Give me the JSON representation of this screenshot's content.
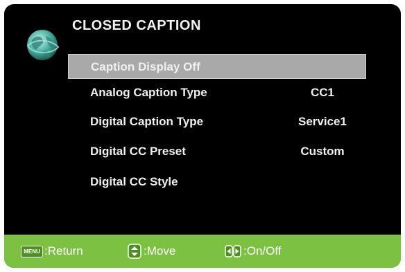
{
  "osd": {
    "title": "CLOSED CAPTION",
    "items": [
      {
        "label": "Caption Display Off",
        "value": "",
        "selected": true
      },
      {
        "label": "Analog Caption Type",
        "value": "CC1"
      },
      {
        "label": "Digital Caption Type",
        "value": "Service1"
      },
      {
        "label": "Digital CC Preset",
        "value": "Custom"
      },
      {
        "label": "Digital CC Style",
        "value": ""
      }
    ],
    "logo_icon": "globe-icon"
  },
  "footer": {
    "menu_key": "MENU",
    "return_label": ":Return",
    "move_label": ":Move",
    "onoff_label": ":On/Off",
    "menu_key_icon": "menu-key-icon",
    "move_icon": "up-down-arrows-icon",
    "onoff_icon": "left-right-arrows-icon"
  },
  "colors": {
    "background": "#000000",
    "highlight": "#a9a9a9",
    "footer": "#7dc142"
  }
}
